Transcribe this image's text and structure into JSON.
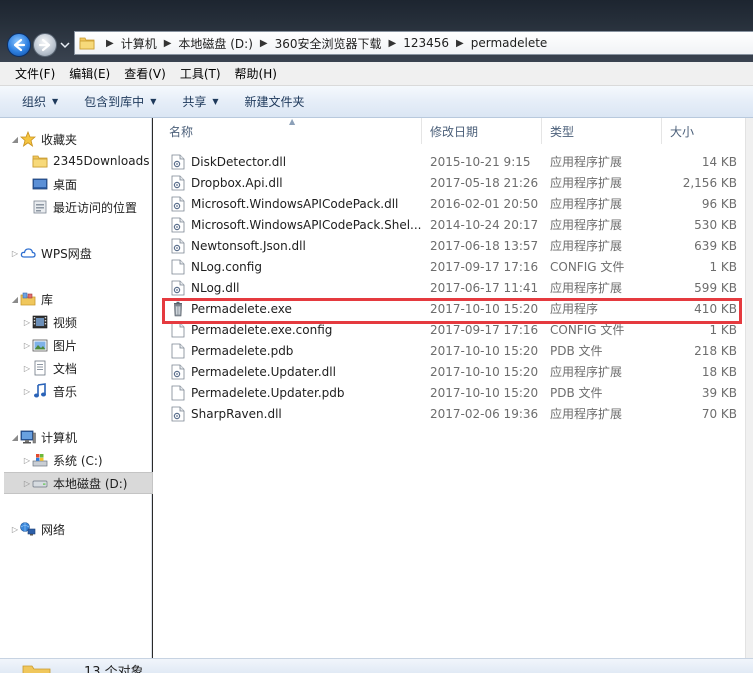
{
  "breadcrumb": [
    "计算机",
    "本地磁盘 (D:)",
    "360安全浏览器下载",
    "123456",
    "permadelete"
  ],
  "menu": [
    "文件(F)",
    "编辑(E)",
    "查看(V)",
    "工具(T)",
    "帮助(H)"
  ],
  "commands": [
    {
      "label": "组织",
      "dropdown": true
    },
    {
      "label": "包含到库中",
      "dropdown": true
    },
    {
      "label": "共享",
      "dropdown": true
    },
    {
      "label": "新建文件夹",
      "dropdown": false
    }
  ],
  "nav": {
    "favorites": {
      "label": "收藏夹",
      "items": [
        "2345Downloads",
        "桌面",
        "最近访问的位置"
      ]
    },
    "wps": {
      "label": "WPS网盘"
    },
    "libraries": {
      "label": "库",
      "items": [
        "视频",
        "图片",
        "文档",
        "音乐"
      ]
    },
    "computer": {
      "label": "计算机",
      "items": [
        "系统 (C:)",
        "本地磁盘 (D:)"
      ]
    },
    "network": {
      "label": "网络"
    }
  },
  "columns": {
    "name": "名称",
    "date": "修改日期",
    "type": "类型",
    "size": "大小"
  },
  "files": [
    {
      "name": "DiskDetector.dll",
      "date": "2015-10-21 9:15",
      "type": "应用程序扩展",
      "size": "14 KB",
      "icon": "dll"
    },
    {
      "name": "Dropbox.Api.dll",
      "date": "2017-05-18 21:26",
      "type": "应用程序扩展",
      "size": "2,156 KB",
      "icon": "dll"
    },
    {
      "name": "Microsoft.WindowsAPICodePack.dll",
      "date": "2016-02-01 20:50",
      "type": "应用程序扩展",
      "size": "96 KB",
      "icon": "dll"
    },
    {
      "name": "Microsoft.WindowsAPICodePack.Shel...",
      "date": "2014-10-24 20:17",
      "type": "应用程序扩展",
      "size": "530 KB",
      "icon": "dll"
    },
    {
      "name": "Newtonsoft.Json.dll",
      "date": "2017-06-18 13:57",
      "type": "应用程序扩展",
      "size": "639 KB",
      "icon": "dll"
    },
    {
      "name": "NLog.config",
      "date": "2017-09-17 17:16",
      "type": "CONFIG 文件",
      "size": "1 KB",
      "icon": "blank"
    },
    {
      "name": "NLog.dll",
      "date": "2017-06-17 11:41",
      "type": "应用程序扩展",
      "size": "599 KB",
      "icon": "dll"
    },
    {
      "name": "Permadelete.exe",
      "date": "2017-10-10 15:20",
      "type": "应用程序",
      "size": "410 KB",
      "icon": "exe"
    },
    {
      "name": "Permadelete.exe.config",
      "date": "2017-09-17 17:16",
      "type": "CONFIG 文件",
      "size": "1 KB",
      "icon": "blank"
    },
    {
      "name": "Permadelete.pdb",
      "date": "2017-10-10 15:20",
      "type": "PDB 文件",
      "size": "218 KB",
      "icon": "blank"
    },
    {
      "name": "Permadelete.Updater.dll",
      "date": "2017-10-10 15:20",
      "type": "应用程序扩展",
      "size": "18 KB",
      "icon": "dll"
    },
    {
      "name": "Permadelete.Updater.pdb",
      "date": "2017-10-10 15:20",
      "type": "PDB 文件",
      "size": "39 KB",
      "icon": "blank"
    },
    {
      "name": "SharpRaven.dll",
      "date": "2017-02-06 19:36",
      "type": "应用程序扩展",
      "size": "70 KB",
      "icon": "dll"
    }
  ],
  "highlighted_file": "Permadelete.exe",
  "status": {
    "count_text": "13 个对象"
  },
  "colors": {
    "highlight": "#e53a3f",
    "accent": "#1e395b"
  }
}
